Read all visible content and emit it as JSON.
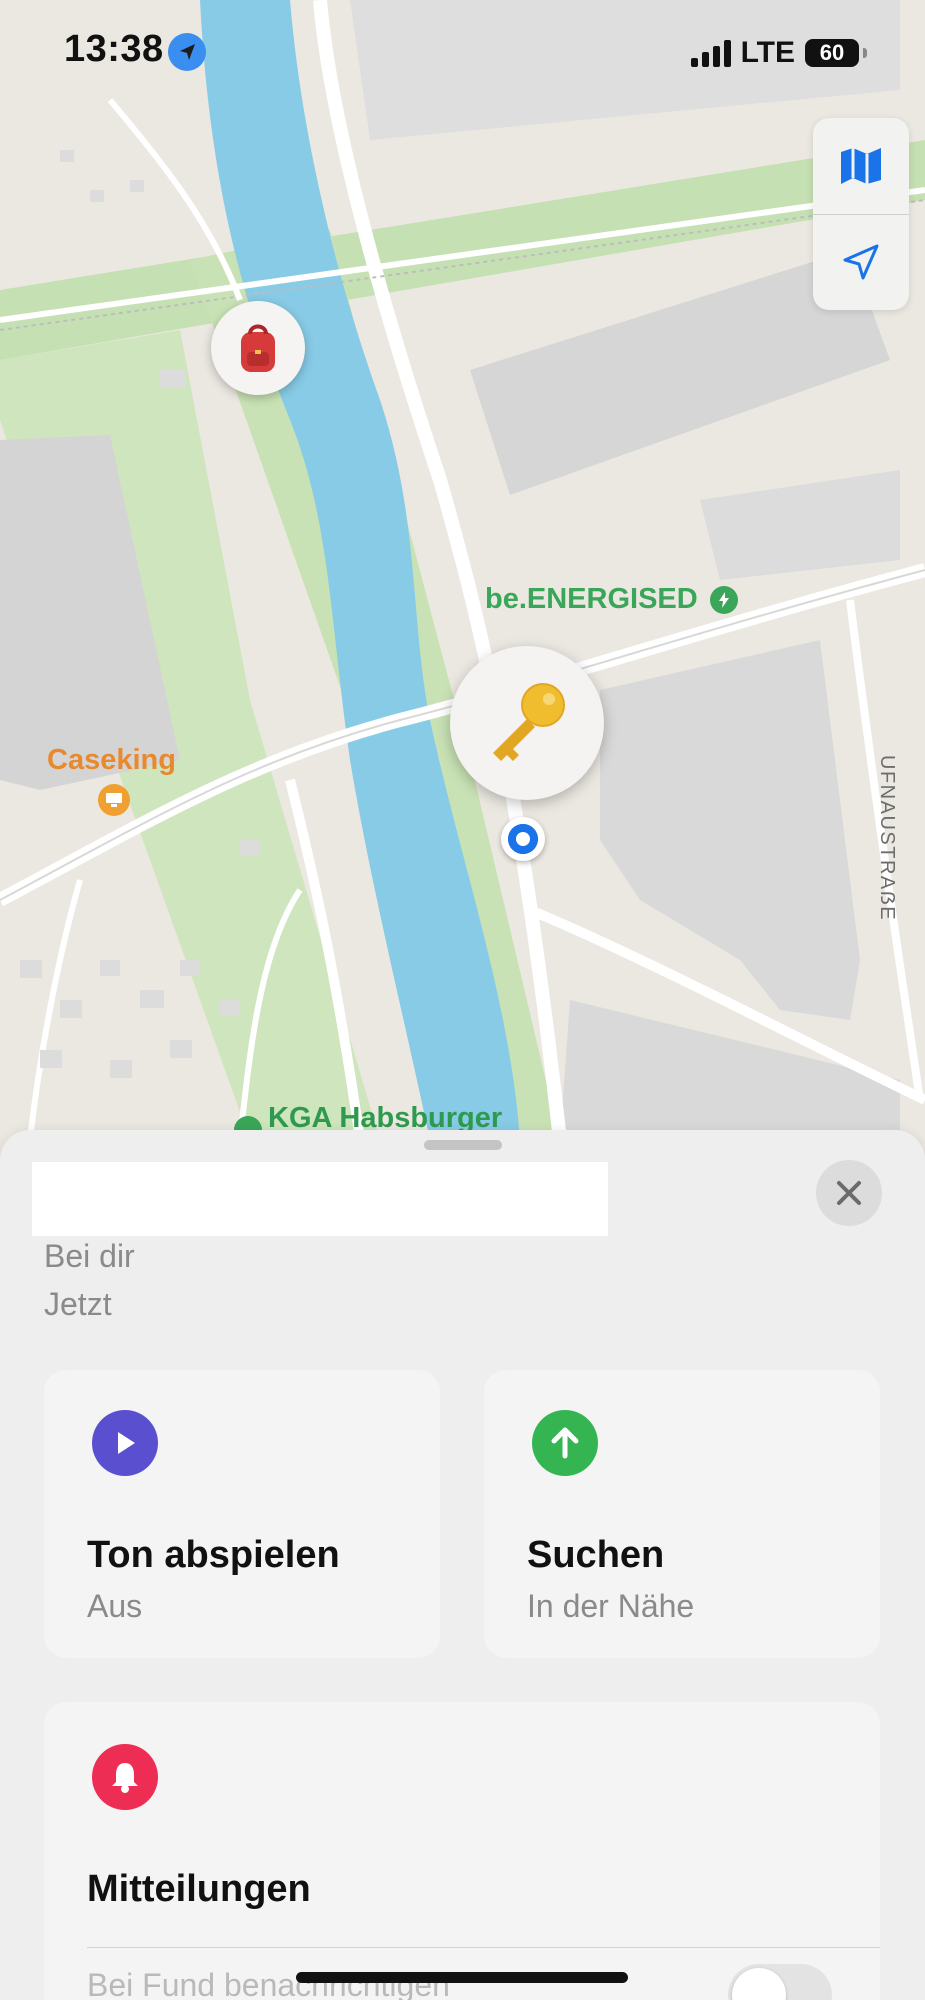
{
  "status_bar": {
    "time": "13:38",
    "network": "LTE",
    "battery": "60",
    "location_icon": "location-arrow-icon"
  },
  "map": {
    "labels": {
      "energised": "be.ENERGISED",
      "caseking": "Caseking",
      "kga": "KGA Habsburger",
      "street": "UFNAUSTRAẞE"
    },
    "controls": {
      "map_mode_icon": "map-icon",
      "locate_icon": "location-arrow-icon"
    },
    "pins": {
      "backpack": "backpack-icon",
      "key": "key-icon"
    }
  },
  "sheet": {
    "subtitle_location": "Bei dir",
    "subtitle_time": "Jetzt",
    "close_icon": "close-icon",
    "actions": {
      "sound": {
        "title": "Ton abspielen",
        "subtitle": "Aus",
        "color": "#5a4fcf"
      },
      "find": {
        "title": "Suchen",
        "subtitle": "In der Nähe",
        "color": "#34b551"
      }
    },
    "notifications": {
      "title": "Mitteilungen",
      "color": "#ee2d55",
      "row_label": "Bei Fund benachrichtigen"
    }
  }
}
